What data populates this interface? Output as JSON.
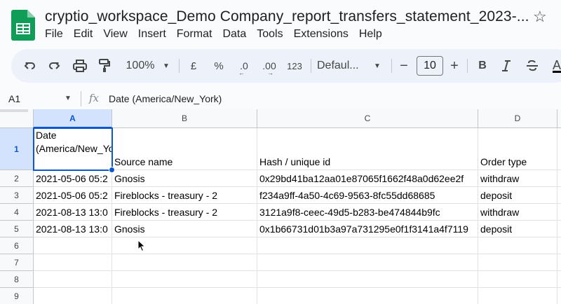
{
  "app": {
    "doc_title": "cryptio_workspace_Demo Company_report_transfers_statement_2023-...",
    "logo_icon": "google-sheets-logo",
    "star_icon": "star-outline-icon",
    "brand_color": "#0f9d58",
    "accent_color": "#0b57d0"
  },
  "menu": [
    "File",
    "Edit",
    "View",
    "Insert",
    "Format",
    "Data",
    "Tools",
    "Extensions",
    "Help"
  ],
  "toolbar": {
    "zoom": "100%",
    "currency": "£",
    "percent": "%",
    "decrease_decimal": ".0",
    "increase_decimal": ".00",
    "number_format": "123",
    "font": "Defaul...",
    "font_size": "10",
    "bold": "B"
  },
  "formula_bar": {
    "cell_ref": "A1",
    "fx": "fx",
    "value": "Date (America/New_York)"
  },
  "sheet": {
    "columns": [
      "A",
      "B",
      "C",
      "D"
    ],
    "row_numbers": [
      "1",
      "2",
      "3",
      "4",
      "5",
      "6",
      "7",
      "8",
      "9"
    ],
    "headers": [
      "Date (America/New_York)",
      "Source name",
      "Hash / unique id",
      "Order type"
    ],
    "rows": [
      [
        "2021-05-06 05:2",
        "Gnosis",
        "0x29bd41ba12aa01e87065f1662f48a0d62ee2f",
        "withdraw"
      ],
      [
        "2021-05-06 05:2",
        "Fireblocks - treasury - 2",
        "f234a9ff-4a50-4c69-9563-8fc55dd68685",
        "deposit"
      ],
      [
        "2021-08-13 13:0",
        "Fireblocks - treasury - 2",
        "3121a9f8-ceec-49d5-b283-be474844b9fc",
        "withdraw"
      ],
      [
        "2021-08-13 13:0",
        "Gnosis",
        "0x1b66731d01b3a97a731295e0f1f3141a4f7119",
        "deposit"
      ]
    ],
    "selected_cell": "A1"
  }
}
